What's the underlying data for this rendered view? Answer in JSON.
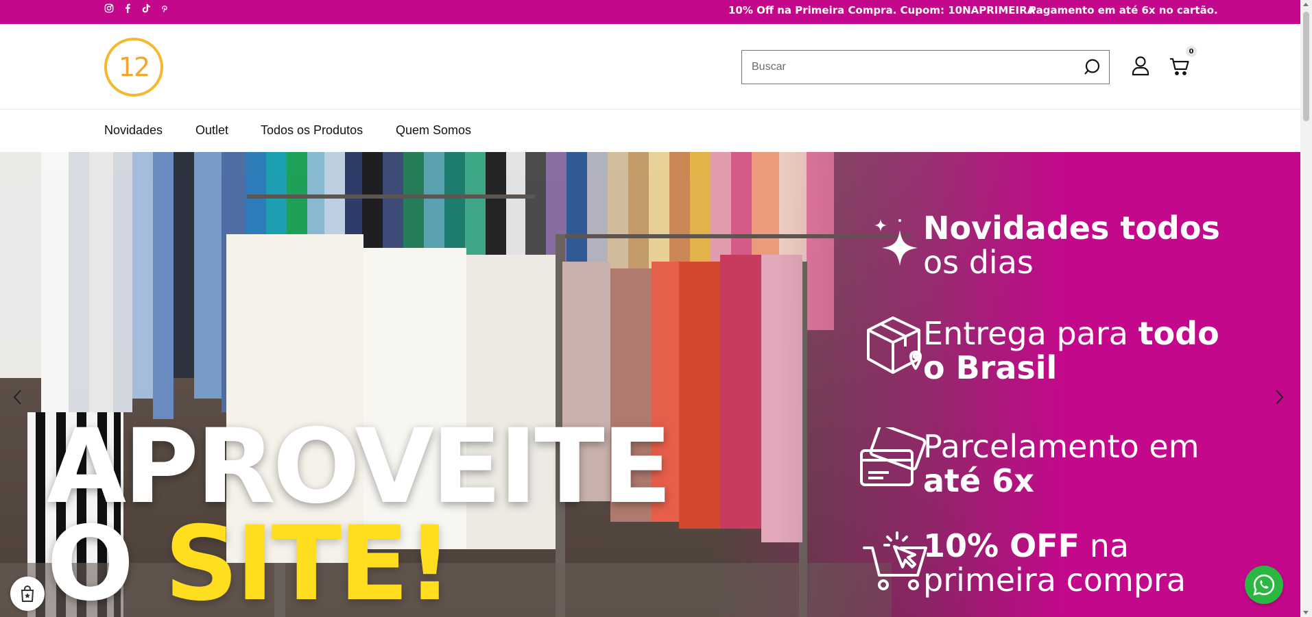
{
  "topbar": {
    "social_icons": [
      "instagram-icon",
      "facebook-icon",
      "tiktok-icon",
      "pinterest-icon"
    ],
    "announcement_1": "10% Off na Primeira Compra. Cupom: 10NAPRIMEIRA",
    "announcement_2": "Pagamento em até 6x no cartão.",
    "background_color": "#c4088c"
  },
  "header": {
    "logo_text": "12",
    "search": {
      "placeholder": "Buscar",
      "value": ""
    },
    "cart_count": "0"
  },
  "nav": {
    "items": [
      {
        "label": "Novidades"
      },
      {
        "label": "Outlet"
      },
      {
        "label": "Todos os Produtos"
      },
      {
        "label": "Quem Somos"
      }
    ]
  },
  "hero": {
    "headline_line1": "APROVEITE",
    "headline_line2_white": "O ",
    "headline_line2_yellow": "SITE!",
    "features": [
      {
        "bold": "Novidades todos",
        "normal": "os dias",
        "icon": "sparkle-icon"
      },
      {
        "normal": "Entrega para ",
        "bold": "todo",
        "bold2": "o Brasil",
        "icon": "package-location-icon"
      },
      {
        "normal": "Parcelamento em",
        "bold": "até 6x",
        "icon": "credit-card-icon"
      },
      {
        "bold": "10% OFF",
        "normal": " na",
        "normal2": "primeira compra",
        "icon": "shopping-cart-click-icon"
      }
    ],
    "accent_color": "#c4088c",
    "headline_yellow": "#ffdd1f"
  },
  "floating": {
    "whatsapp_icon": "whatsapp-icon",
    "badge_icon": "shopping-bag-badge-icon"
  }
}
